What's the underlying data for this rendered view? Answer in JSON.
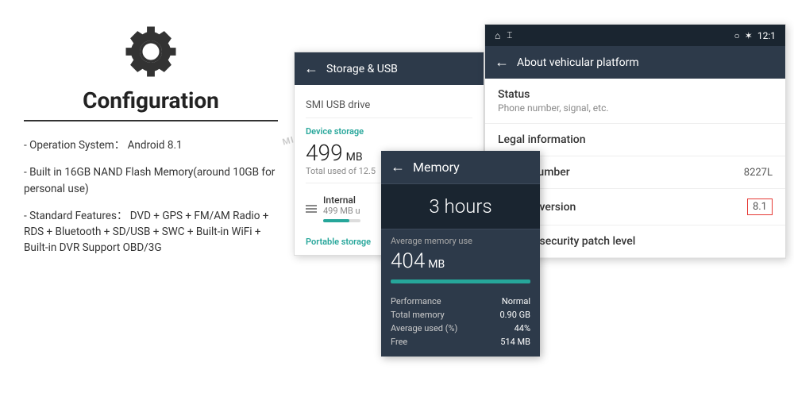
{
  "left": {
    "title": "Configuration",
    "items": [
      "- Operation System： Android 8.1",
      "- Built in 16GB NAND Flash Memory(around 10GB for personal use)",
      "- Standard Features： DVD + GPS + FM/AM Radio + RDS + Bluetooth + SD/USB + SWC + Built-in WiFi + Built-in DVR Support OBD/3G"
    ]
  },
  "storage": {
    "header": "Storage & USB",
    "smi_label": "SMI USB drive",
    "device_storage_label": "Device storage",
    "size": "499",
    "size_unit": "MB",
    "total_used": "Total used of 12.5",
    "internal_label": "Internal",
    "internal_sub": "499 MB u",
    "portable_label": "Portable storage"
  },
  "memory": {
    "title": "Memory",
    "hours": "3 hours",
    "avg_label": "Average memory use",
    "avg_value": "404",
    "avg_unit": "MB",
    "stats": [
      {
        "label": "Performance",
        "value": "Normal"
      },
      {
        "label": "Total memory",
        "value": "0.90 GB"
      },
      {
        "label": "Average used (%)",
        "value": "44%"
      },
      {
        "label": "Free",
        "value": "514 MB"
      }
    ]
  },
  "about": {
    "status_bar": {
      "time": "12:1",
      "icons": [
        "location",
        "bluetooth"
      ]
    },
    "header": "About vehicular platform",
    "items": [
      {
        "type": "with_sub",
        "title": "Status",
        "sub": "Phone number, signal, etc."
      },
      {
        "type": "simple",
        "title": "Legal information"
      },
      {
        "type": "with_value",
        "title": "Model number",
        "value": "8227L"
      },
      {
        "type": "android_version",
        "title": "Android version",
        "value": "8.1"
      },
      {
        "type": "simple",
        "title": "Android security patch level"
      }
    ]
  },
  "watermark": "MICHIONE"
}
